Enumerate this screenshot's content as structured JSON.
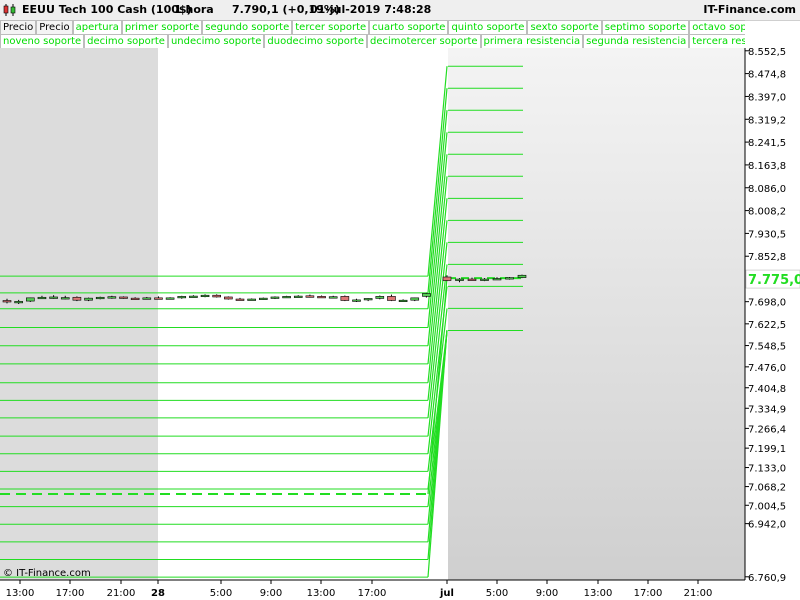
{
  "header": {
    "instrument": "EEUU Tech 100 Cash (100$)",
    "timeframe": "1 hora",
    "last_price": "7.790,1 (+0,19%)",
    "datetime": "01-jul-2019 7:48:28",
    "brand": "IT-Finance.com"
  },
  "legend": {
    "row1": [
      "Precio",
      "Precio",
      "apertura",
      "primer soporte",
      "segundo soporte",
      "tercer soporte",
      "cuarto soporte",
      "quinto soporte",
      "sexto soporte",
      "septimo soporte",
      "octavo soporte"
    ],
    "row2": [
      "noveno soporte",
      "decimo soporte",
      "undecimo soporte",
      "duodecimo soporte",
      "decimotercer soporte",
      "primera resistencia",
      "segunda resistencia",
      "tercera resistencia"
    ]
  },
  "footer": {
    "copyright": "© IT-Finance.com"
  },
  "colors": {
    "level_line": "#22dd22",
    "bull_candle": "#55cc55",
    "bear_candle": "#dd7777",
    "wick": "#000000",
    "shade": "#dcdcdc"
  },
  "chart_data": {
    "type": "candlestick",
    "title": "EEUU Tech 100 Cash (100$)",
    "current_price": "7.775,0",
    "y_tick_labels": [
      "8.552,5",
      "8.474,8",
      "8.397,0",
      "8.319,2",
      "8.241,5",
      "8.163,8",
      "8.086,0",
      "8.008,2",
      "7.930,5",
      "7.852,8",
      "7.698,0",
      "7.622,5",
      "7.548,5",
      "7.476,0",
      "7.404,8",
      "7.334,9",
      "7.266,4",
      "7.199,1",
      "7.133,0",
      "7.068,2",
      "7.004,5",
      "6.942,0",
      "6.760,9"
    ],
    "y_tick_values": [
      8552.5,
      8474.8,
      8397.0,
      8319.2,
      8241.5,
      8163.8,
      8086.0,
      8008.2,
      7930.5,
      7852.8,
      7698.0,
      7622.5,
      7548.5,
      7476.0,
      7404.8,
      7334.9,
      7266.4,
      7199.1,
      7133.0,
      7068.2,
      7004.5,
      6942.0,
      6760.9
    ],
    "x_tick_labels": [
      "13:00",
      "17:00",
      "21:00",
      "28",
      "5:00",
      "9:00",
      "13:00",
      "17:00",
      "jul",
      "5:00",
      "9:00",
      "13:00",
      "17:00",
      "21:00"
    ],
    "x_tick_bold": [
      false,
      false,
      false,
      true,
      false,
      false,
      false,
      false,
      true,
      false,
      false,
      false,
      false,
      false
    ],
    "levels_before": [
      7785,
      7728,
      7674,
      7610,
      7548,
      7486,
      7422,
      7362,
      7302,
      7240,
      7180,
      7120,
      7060,
      7000,
      6940,
      6880,
      6820,
      6760
    ],
    "apertura_before": 7043,
    "levels_after": [
      8500,
      8425,
      8350,
      8275,
      8200,
      8125,
      8050,
      7975,
      7900,
      7825,
      7750,
      7675,
      7600
    ],
    "apertura_after": 7778,
    "candles": [
      {
        "o": 7702,
        "h": 7708,
        "l": 7692,
        "c": 7700
      },
      {
        "o": 7698,
        "h": 7704,
        "l": 7690,
        "c": 7699
      },
      {
        "o": 7700,
        "h": 7712,
        "l": 7697,
        "c": 7711
      },
      {
        "o": 7712,
        "h": 7718,
        "l": 7708,
        "c": 7713
      },
      {
        "o": 7713,
        "h": 7720,
        "l": 7708,
        "c": 7714
      },
      {
        "o": 7712,
        "h": 7718,
        "l": 7706,
        "c": 7712
      },
      {
        "o": 7713,
        "h": 7716,
        "l": 7700,
        "c": 7703
      },
      {
        "o": 7703,
        "h": 7712,
        "l": 7700,
        "c": 7710
      },
      {
        "o": 7710,
        "h": 7715,
        "l": 7706,
        "c": 7713
      },
      {
        "o": 7713,
        "h": 7718,
        "l": 7708,
        "c": 7715
      },
      {
        "o": 7714,
        "h": 7716,
        "l": 7708,
        "c": 7710
      },
      {
        "o": 7710,
        "h": 7713,
        "l": 7706,
        "c": 7709
      },
      {
        "o": 7709,
        "h": 7714,
        "l": 7706,
        "c": 7711
      },
      {
        "o": 7711,
        "h": 7716,
        "l": 7707,
        "c": 7710
      },
      {
        "o": 7710,
        "h": 7713,
        "l": 7706,
        "c": 7711
      },
      {
        "o": 7711,
        "h": 7718,
        "l": 7708,
        "c": 7716
      },
      {
        "o": 7716,
        "h": 7720,
        "l": 7712,
        "c": 7717
      },
      {
        "o": 7717,
        "h": 7723,
        "l": 7713,
        "c": 7720
      },
      {
        "o": 7720,
        "h": 7723,
        "l": 7712,
        "c": 7714
      },
      {
        "o": 7714,
        "h": 7716,
        "l": 7705,
        "c": 7707
      },
      {
        "o": 7707,
        "h": 7711,
        "l": 7703,
        "c": 7706
      },
      {
        "o": 7706,
        "h": 7709,
        "l": 7703,
        "c": 7707
      },
      {
        "o": 7707,
        "h": 7712,
        "l": 7704,
        "c": 7710
      },
      {
        "o": 7710,
        "h": 7716,
        "l": 7707,
        "c": 7714
      },
      {
        "o": 7714,
        "h": 7718,
        "l": 7711,
        "c": 7716
      },
      {
        "o": 7716,
        "h": 7720,
        "l": 7713,
        "c": 7717
      },
      {
        "o": 7718,
        "h": 7722,
        "l": 7712,
        "c": 7716
      },
      {
        "o": 7716,
        "h": 7719,
        "l": 7712,
        "c": 7714
      },
      {
        "o": 7714,
        "h": 7718,
        "l": 7710,
        "c": 7715
      },
      {
        "o": 7716,
        "h": 7719,
        "l": 7700,
        "c": 7702
      },
      {
        "o": 7702,
        "h": 7708,
        "l": 7697,
        "c": 7704
      },
      {
        "o": 7704,
        "h": 7710,
        "l": 7700,
        "c": 7709
      },
      {
        "o": 7709,
        "h": 7719,
        "l": 7706,
        "c": 7716
      },
      {
        "o": 7716,
        "h": 7722,
        "l": 7700,
        "c": 7702
      },
      {
        "o": 7702,
        "h": 7706,
        "l": 7698,
        "c": 7703
      },
      {
        "o": 7703,
        "h": 7712,
        "l": 7700,
        "c": 7711
      },
      {
        "o": 7716,
        "h": 7728,
        "l": 7712,
        "c": 7726
      },
      {
        "o": 7782,
        "h": 7788,
        "l": 7768,
        "c": 7770
      },
      {
        "o": 7772,
        "h": 7778,
        "l": 7764,
        "c": 7775
      },
      {
        "o": 7775,
        "h": 7780,
        "l": 7770,
        "c": 7773
      },
      {
        "o": 7773,
        "h": 7778,
        "l": 7768,
        "c": 7775
      },
      {
        "o": 7775,
        "h": 7781,
        "l": 7772,
        "c": 7777
      },
      {
        "o": 7777,
        "h": 7782,
        "l": 7773,
        "c": 7780
      },
      {
        "o": 7780,
        "h": 7790,
        "l": 7778,
        "c": 7788
      }
    ]
  }
}
